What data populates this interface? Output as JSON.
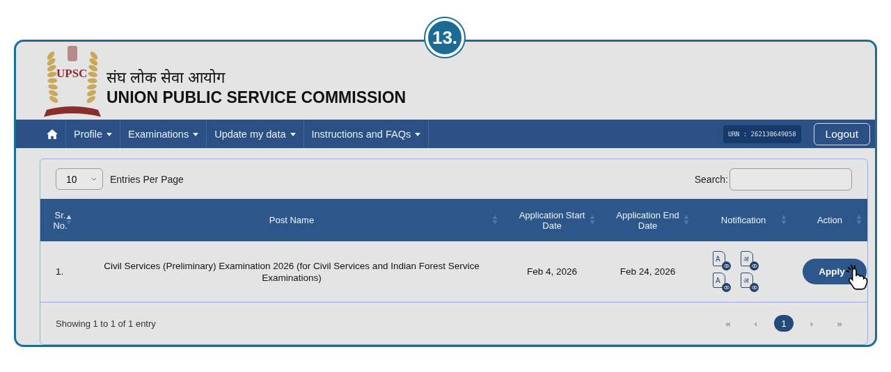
{
  "step_badge": "13.",
  "header": {
    "logo_text": "UPSC",
    "title_hindi": "संघ लोक सेवा आयोग",
    "title": "UNION PUBLIC SERVICE COMMISSION"
  },
  "nav": {
    "items": [
      {
        "label": "Profile",
        "dropdown": true
      },
      {
        "label": "Examinations",
        "dropdown": true
      },
      {
        "label": "Update my data",
        "dropdown": true
      },
      {
        "label": "Instructions and FAQs",
        "dropdown": true
      }
    ],
    "urn": "URN : 262130649058",
    "logout": "Logout"
  },
  "table_controls": {
    "page_size": "10",
    "page_size_label": "Entries Per Page",
    "search_label": "Search:"
  },
  "table": {
    "columns": [
      {
        "label": "Sr. No.",
        "sorted": true
      },
      {
        "label": "Post Name",
        "sorted": false
      },
      {
        "label": "Application Start Date",
        "sorted": false
      },
      {
        "label": "Application End Date",
        "sorted": false
      },
      {
        "label": "Notification",
        "sorted": false
      },
      {
        "label": "Action",
        "sorted": false
      }
    ],
    "rows": [
      {
        "sr": "1.",
        "post": "Civil Services (Preliminary) Examination 2026 (for Civil Services and Indian Forest Service Examinations)",
        "start": "Feb 4, 2026",
        "end": "Feb 24, 2026",
        "notifications": [
          "A",
          "अ",
          "A",
          "अ"
        ],
        "action": "Apply"
      }
    ]
  },
  "footer": {
    "info": "Showing 1 to 1 of 1 entry",
    "pages": [
      {
        "label": "«",
        "selected": false
      },
      {
        "label": "‹",
        "selected": false
      },
      {
        "label": "1",
        "selected": true
      },
      {
        "label": "›",
        "selected": false
      },
      {
        "label": "»",
        "selected": false
      }
    ]
  }
}
